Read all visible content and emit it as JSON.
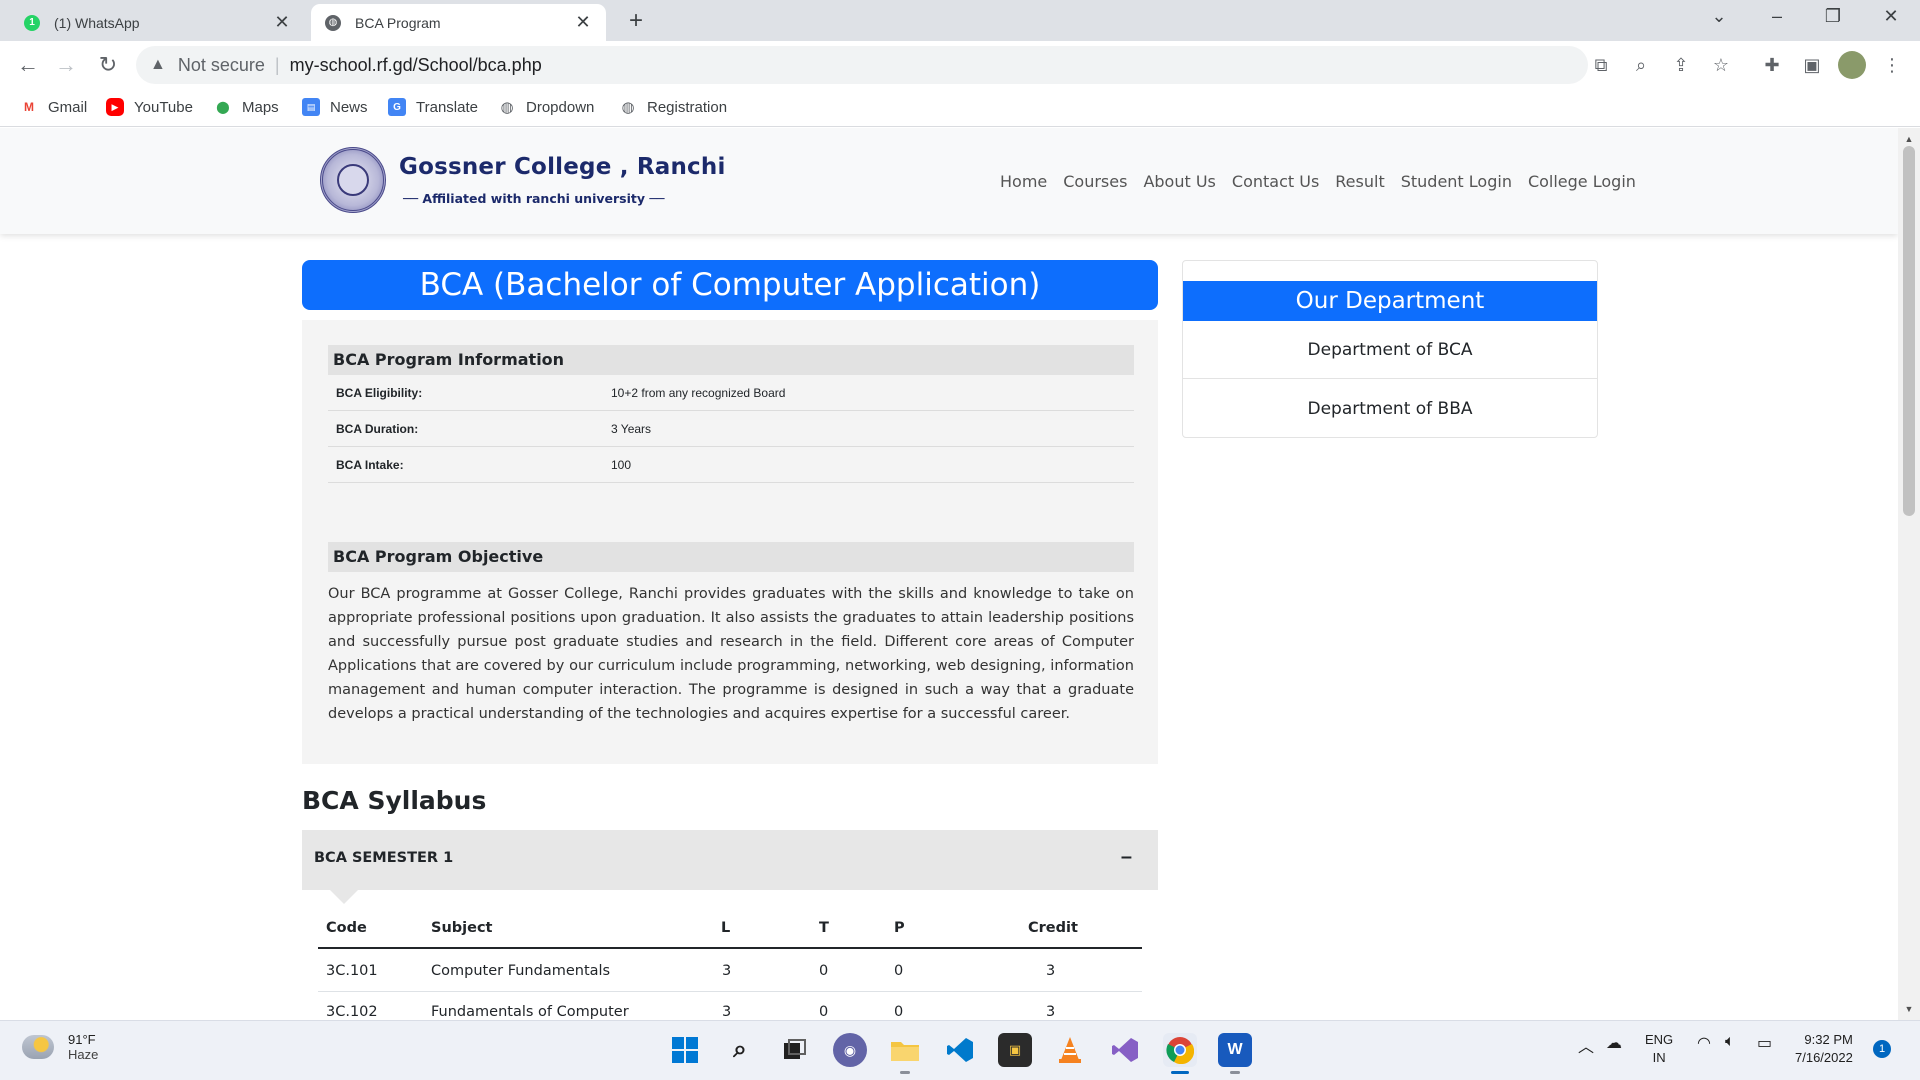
{
  "browser": {
    "tabs": [
      {
        "title": "(1) WhatsApp",
        "badge": "1",
        "active": false
      },
      {
        "title": "BCA Program",
        "active": true
      }
    ],
    "new_tab": "+",
    "address": {
      "security_label": "Not secure",
      "url": "my-school.rf.gd/School/bca.php"
    },
    "bookmarks": [
      {
        "label": "Gmail",
        "icon": "gmail-icon"
      },
      {
        "label": "YouTube",
        "icon": "youtube-icon"
      },
      {
        "label": "Maps",
        "icon": "maps-icon"
      },
      {
        "label": "News",
        "icon": "news-icon"
      },
      {
        "label": "Translate",
        "icon": "translate-icon"
      },
      {
        "label": "Dropdown",
        "icon": "globe-icon"
      },
      {
        "label": "Registration",
        "icon": "globe-icon"
      }
    ]
  },
  "site": {
    "brand": {
      "name": "Gossner College , Ranchi",
      "tagline": "── Affiliated with ranchi university ──"
    },
    "nav": [
      "Home",
      "Courses",
      "About Us",
      "Contact Us",
      "Result",
      "Student Login",
      "College Login"
    ]
  },
  "program": {
    "title": "BCA (Bachelor of Computer Application)",
    "info_heading": "BCA Program Information",
    "info": [
      {
        "key": "BCA Eligibility:",
        "value": "10+2 from any recognized Board"
      },
      {
        "key": "BCA Duration:",
        "value": "3 Years"
      },
      {
        "key": "BCA Intake:",
        "value": "100"
      }
    ],
    "objective_heading": "BCA Program Objective",
    "objective_text": "Our BCA programme at Gosser College, Ranchi provides graduates with the skills and knowledge to take on appropriate professional positions upon graduation. It also assists the graduates to attain leadership positions and successfully pursue post graduate studies and research in the field. Different core areas of Computer Applications that are covered by our curriculum include programming, networking, web designing, information management and human computer interaction. The programme is designed in such a way that a graduate develops a practical understanding of the technologies and acquires expertise for a successful career."
  },
  "department": {
    "heading": "Our Department",
    "items": [
      "Department of BCA",
      "Department of BBA"
    ]
  },
  "syllabus": {
    "title": "BCA Syllabus",
    "semester_label": "BCA SEMESTER 1",
    "toggle": "–",
    "columns": [
      "Code",
      "Subject",
      "L",
      "T",
      "P",
      "Credit"
    ],
    "rows": [
      [
        "3C.101",
        "Computer Fundamentals",
        "3",
        "0",
        "0",
        "3"
      ],
      [
        "3C.102",
        "Fundamentals of Computer",
        "3",
        "0",
        "0",
        "3"
      ]
    ]
  },
  "taskbar": {
    "weather": {
      "temp": "91°F",
      "condition": "Haze"
    },
    "language": {
      "line1": "ENG",
      "line2": "IN"
    },
    "time": "9:32 PM",
    "date": "7/16/2022",
    "notification_count": "1"
  },
  "colors": {
    "primary": "#0d6efd",
    "brand_text": "#1c2a6b",
    "panel_bg": "#f4f4f4"
  }
}
